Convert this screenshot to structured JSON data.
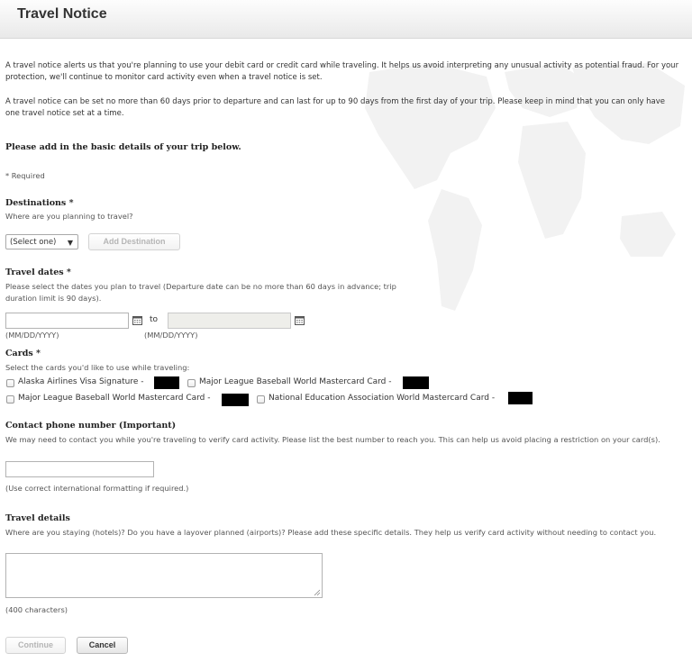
{
  "header": {
    "title": "Travel Notice"
  },
  "intro": {
    "p1": "A travel notice alerts us that you're planning to use your debit card or credit card while traveling. It helps us avoid interpreting any unusual activity as potential fraud. For your protection, we'll continue to monitor card activity even when a travel notice is set.",
    "p2": "A travel notice can be set no more than 60 days prior to departure and can last for up to 90 days from the first day of your trip. Please keep in mind that you can only have one travel notice set at a time."
  },
  "basic_details_heading": "Please add in the basic details of your trip below.",
  "required_note": "* Required",
  "destinations": {
    "label": "Destinations *",
    "help": "Where are you planning to travel?",
    "select_value": "(Select one)",
    "add_button": "Add Destination"
  },
  "travel_dates": {
    "label": "Travel dates *",
    "help": "Please select the dates you plan to travel (Departure date can be no more than 60 days in advance; trip duration limit is 90 days).",
    "to": "to",
    "start_hint": "(MM/DD/YYYY)",
    "end_hint": "(MM/DD/YYYY)"
  },
  "cards": {
    "label": "Cards *",
    "help": "Select the cards you'd like to use while traveling:",
    "items": [
      {
        "label": "Alaska Airlines Visa Signature -"
      },
      {
        "label": "Major League Baseball World Mastercard Card -"
      },
      {
        "label": "Major League Baseball World Mastercard Card -"
      },
      {
        "label": "National Education Association World Mastercard Card -"
      }
    ]
  },
  "phone": {
    "label": "Contact phone number (Important)",
    "help": "We may need to contact you while you're traveling to verify card activity. Please list the best number to reach you. This can help us avoid placing a restriction on your card(s).",
    "hint": "(Use correct international formatting if required.)"
  },
  "details": {
    "label": "Travel details",
    "help": "Where are you staying (hotels)? Do you have a layover planned (airports)? Please add these specific details. They help us verify card activity without needing to contact you.",
    "hint": "(400 characters)"
  },
  "actions": {
    "continue": "Continue",
    "cancel": "Cancel"
  },
  "icons": {
    "calendar": "calendar-icon",
    "dropdown": "triangle-down-icon",
    "checkbox": "checkbox-icon"
  },
  "colors": {
    "redaction": "#000000",
    "map": "#f3f3f3"
  }
}
